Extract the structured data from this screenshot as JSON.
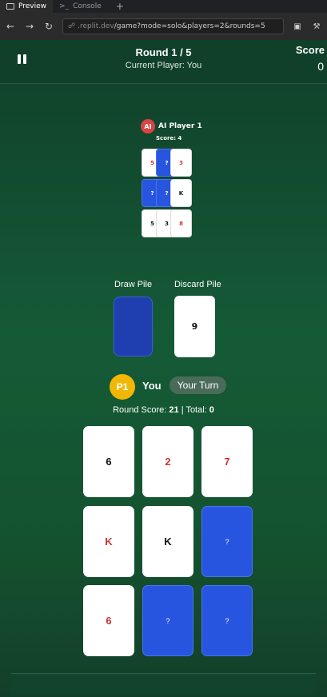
{
  "browser": {
    "tabs": [
      {
        "label": "Preview"
      },
      {
        "label": "Console"
      }
    ],
    "url_host": ".replit.dev",
    "url_path": "/game?mode=solo&players=2&rounds=5"
  },
  "header": {
    "round_text": "Round 1 / 5",
    "current_player_text": "Current Player: You",
    "score_label": "Score",
    "score_value": "0"
  },
  "ai_player": {
    "badge": "AI",
    "name": "AI Player 1",
    "score_text": "Score: 4",
    "cards": [
      {
        "label": "5",
        "state": "face-up",
        "color": "red"
      },
      {
        "label": "?",
        "state": "face-down"
      },
      {
        "label": "3",
        "state": "face-up",
        "color": "red"
      },
      {
        "label": "?",
        "state": "face-down"
      },
      {
        "label": "?",
        "state": "face-down"
      },
      {
        "label": "K",
        "state": "face-up",
        "color": "black"
      },
      {
        "label": "5",
        "state": "face-up",
        "color": "black"
      },
      {
        "label": "3",
        "state": "face-up",
        "color": "black"
      },
      {
        "label": "8",
        "state": "face-up",
        "color": "red"
      }
    ]
  },
  "piles": {
    "draw_label": "Draw Pile",
    "discard_label": "Discard Pile",
    "discard_top": "9"
  },
  "player": {
    "badge": "P1",
    "name": "You",
    "turn_badge": "Your Turn",
    "round_score_label": "Round Score:",
    "round_score_value": "21",
    "separator": "|",
    "total_label": "Total:",
    "total_value": "0",
    "cards": [
      {
        "label": "6",
        "state": "face-up",
        "color": "black"
      },
      {
        "label": "2",
        "state": "face-up",
        "color": "red"
      },
      {
        "label": "7",
        "state": "face-up",
        "color": "red"
      },
      {
        "label": "K",
        "state": "face-up",
        "color": "red"
      },
      {
        "label": "K",
        "state": "face-up",
        "color": "black"
      },
      {
        "label": "?",
        "state": "face-down"
      },
      {
        "label": "6",
        "state": "face-up",
        "color": "red"
      },
      {
        "label": "?",
        "state": "face-down"
      },
      {
        "label": "?",
        "state": "face-down"
      }
    ]
  },
  "colors": {
    "table_green": "#155a37",
    "card_back_blue": "#2855e0",
    "ai_badge_red": "#d84444",
    "player_badge_yellow": "#f2b705"
  }
}
